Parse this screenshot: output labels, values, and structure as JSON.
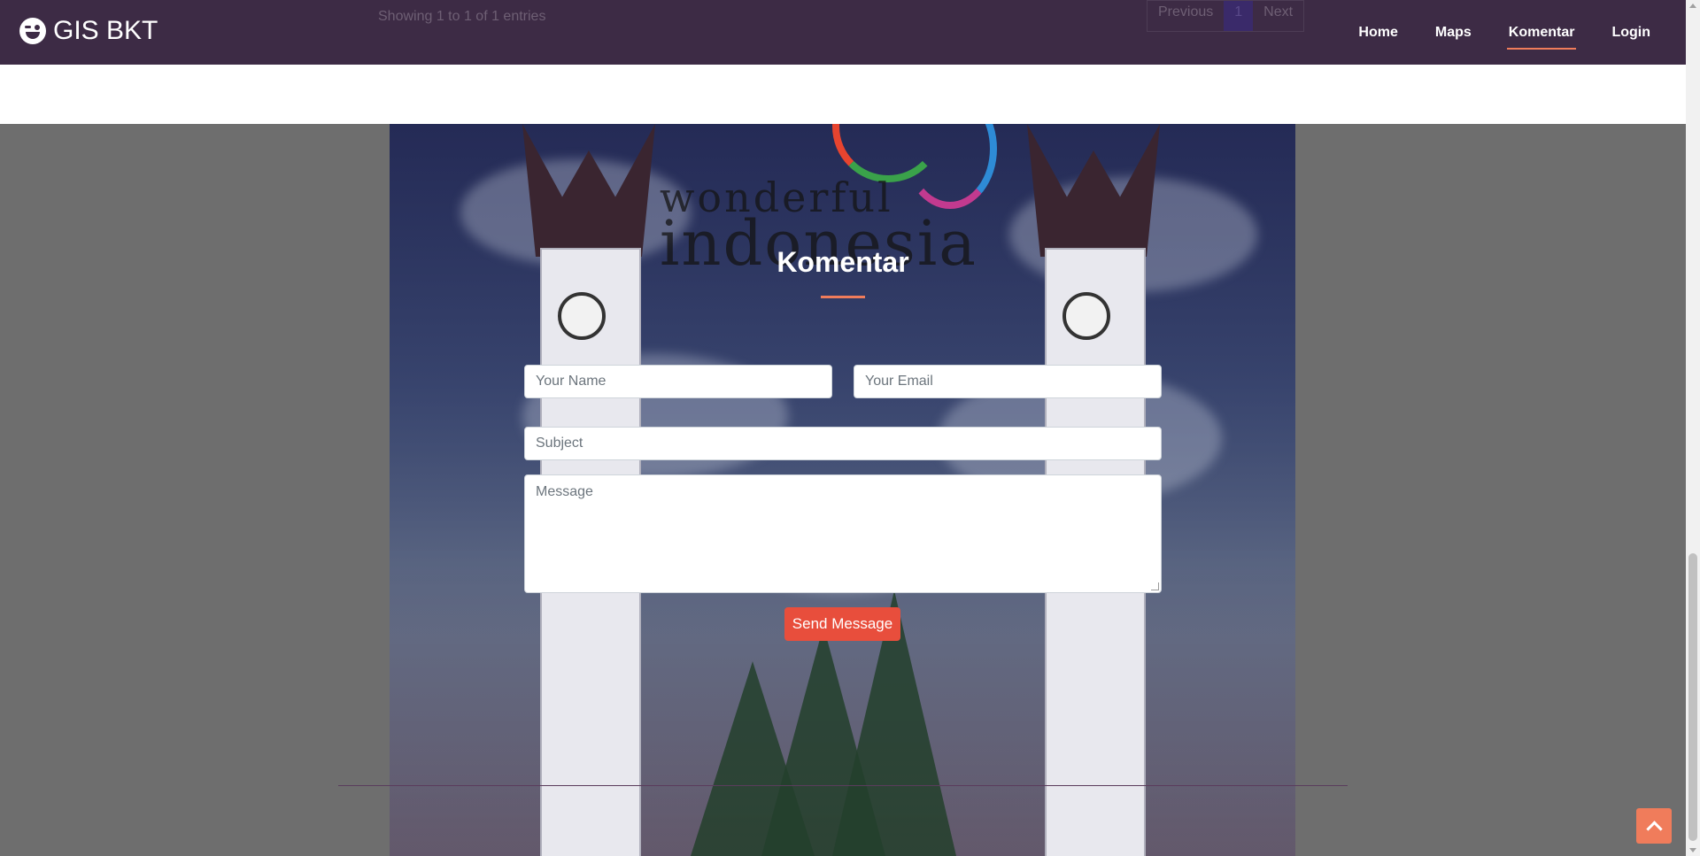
{
  "brand": {
    "name": "GIS BKT",
    "icon": "wink-face-icon"
  },
  "nav": {
    "items": [
      {
        "label": "Home",
        "active": false
      },
      {
        "label": "Maps",
        "active": false
      },
      {
        "label": "Komentar",
        "active": true
      },
      {
        "label": "Login",
        "active": false
      }
    ]
  },
  "table_footer": {
    "showing": "Showing 1 to 1 of 1 entries",
    "previous": "Previous",
    "page": "1",
    "next": "Next"
  },
  "hero": {
    "logo_line1": "wonderful",
    "logo_line2": "indonesia"
  },
  "contact": {
    "title": "Komentar",
    "name_placeholder": "Your Name",
    "email_placeholder": "Your Email",
    "subject_placeholder": "Subject",
    "message_placeholder": "Message",
    "send_label": "Send Message"
  },
  "colors": {
    "navbar": "#3d2b45",
    "accent": "#f07c5b",
    "send_button": "#e84e3c"
  },
  "back_to_top_icon": "chevron-up-icon"
}
